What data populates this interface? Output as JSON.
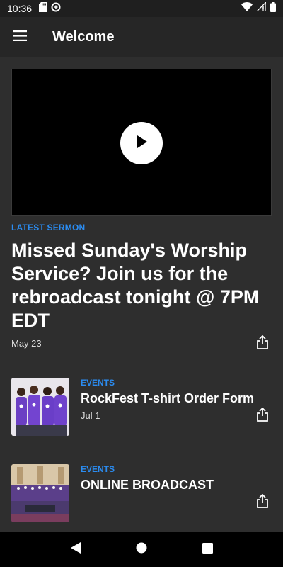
{
  "status_bar": {
    "time": "10:36"
  },
  "app_bar": {
    "title": "Welcome"
  },
  "featured": {
    "category": "LATEST SERMON",
    "title": "Missed Sunday's Worship Service? Join us for the rebroadcast tonight @ 7PM EDT",
    "date": "May 23"
  },
  "items": [
    {
      "category": "EVENTS",
      "title": "RockFest T-shirt Order Form",
      "date": "Jul 1"
    },
    {
      "category": "EVENTS",
      "title": "ONLINE BROADCAST",
      "date": ""
    }
  ],
  "colors": {
    "accent": "#2b8cf1",
    "background": "#2e2e2e",
    "app_bar": "#262626"
  }
}
